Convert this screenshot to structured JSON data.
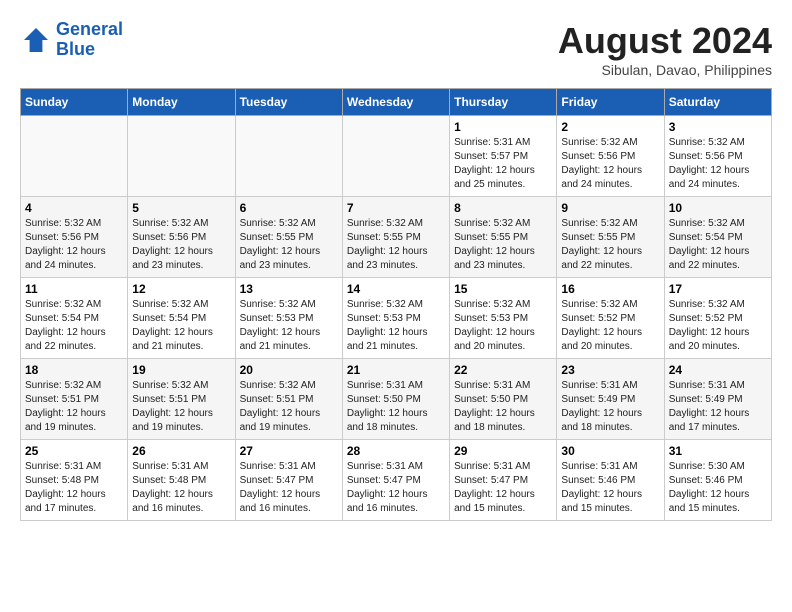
{
  "header": {
    "logo_line1": "General",
    "logo_line2": "Blue",
    "month_year": "August 2024",
    "location": "Sibulan, Davao, Philippines"
  },
  "weekdays": [
    "Sunday",
    "Monday",
    "Tuesday",
    "Wednesday",
    "Thursday",
    "Friday",
    "Saturday"
  ],
  "weeks": [
    [
      {
        "day": "",
        "info": ""
      },
      {
        "day": "",
        "info": ""
      },
      {
        "day": "",
        "info": ""
      },
      {
        "day": "",
        "info": ""
      },
      {
        "day": "1",
        "info": "Sunrise: 5:31 AM\nSunset: 5:57 PM\nDaylight: 12 hours\nand 25 minutes."
      },
      {
        "day": "2",
        "info": "Sunrise: 5:32 AM\nSunset: 5:56 PM\nDaylight: 12 hours\nand 24 minutes."
      },
      {
        "day": "3",
        "info": "Sunrise: 5:32 AM\nSunset: 5:56 PM\nDaylight: 12 hours\nand 24 minutes."
      }
    ],
    [
      {
        "day": "4",
        "info": "Sunrise: 5:32 AM\nSunset: 5:56 PM\nDaylight: 12 hours\nand 24 minutes."
      },
      {
        "day": "5",
        "info": "Sunrise: 5:32 AM\nSunset: 5:56 PM\nDaylight: 12 hours\nand 23 minutes."
      },
      {
        "day": "6",
        "info": "Sunrise: 5:32 AM\nSunset: 5:55 PM\nDaylight: 12 hours\nand 23 minutes."
      },
      {
        "day": "7",
        "info": "Sunrise: 5:32 AM\nSunset: 5:55 PM\nDaylight: 12 hours\nand 23 minutes."
      },
      {
        "day": "8",
        "info": "Sunrise: 5:32 AM\nSunset: 5:55 PM\nDaylight: 12 hours\nand 23 minutes."
      },
      {
        "day": "9",
        "info": "Sunrise: 5:32 AM\nSunset: 5:55 PM\nDaylight: 12 hours\nand 22 minutes."
      },
      {
        "day": "10",
        "info": "Sunrise: 5:32 AM\nSunset: 5:54 PM\nDaylight: 12 hours\nand 22 minutes."
      }
    ],
    [
      {
        "day": "11",
        "info": "Sunrise: 5:32 AM\nSunset: 5:54 PM\nDaylight: 12 hours\nand 22 minutes."
      },
      {
        "day": "12",
        "info": "Sunrise: 5:32 AM\nSunset: 5:54 PM\nDaylight: 12 hours\nand 21 minutes."
      },
      {
        "day": "13",
        "info": "Sunrise: 5:32 AM\nSunset: 5:53 PM\nDaylight: 12 hours\nand 21 minutes."
      },
      {
        "day": "14",
        "info": "Sunrise: 5:32 AM\nSunset: 5:53 PM\nDaylight: 12 hours\nand 21 minutes."
      },
      {
        "day": "15",
        "info": "Sunrise: 5:32 AM\nSunset: 5:53 PM\nDaylight: 12 hours\nand 20 minutes."
      },
      {
        "day": "16",
        "info": "Sunrise: 5:32 AM\nSunset: 5:52 PM\nDaylight: 12 hours\nand 20 minutes."
      },
      {
        "day": "17",
        "info": "Sunrise: 5:32 AM\nSunset: 5:52 PM\nDaylight: 12 hours\nand 20 minutes."
      }
    ],
    [
      {
        "day": "18",
        "info": "Sunrise: 5:32 AM\nSunset: 5:51 PM\nDaylight: 12 hours\nand 19 minutes."
      },
      {
        "day": "19",
        "info": "Sunrise: 5:32 AM\nSunset: 5:51 PM\nDaylight: 12 hours\nand 19 minutes."
      },
      {
        "day": "20",
        "info": "Sunrise: 5:32 AM\nSunset: 5:51 PM\nDaylight: 12 hours\nand 19 minutes."
      },
      {
        "day": "21",
        "info": "Sunrise: 5:31 AM\nSunset: 5:50 PM\nDaylight: 12 hours\nand 18 minutes."
      },
      {
        "day": "22",
        "info": "Sunrise: 5:31 AM\nSunset: 5:50 PM\nDaylight: 12 hours\nand 18 minutes."
      },
      {
        "day": "23",
        "info": "Sunrise: 5:31 AM\nSunset: 5:49 PM\nDaylight: 12 hours\nand 18 minutes."
      },
      {
        "day": "24",
        "info": "Sunrise: 5:31 AM\nSunset: 5:49 PM\nDaylight: 12 hours\nand 17 minutes."
      }
    ],
    [
      {
        "day": "25",
        "info": "Sunrise: 5:31 AM\nSunset: 5:48 PM\nDaylight: 12 hours\nand 17 minutes."
      },
      {
        "day": "26",
        "info": "Sunrise: 5:31 AM\nSunset: 5:48 PM\nDaylight: 12 hours\nand 16 minutes."
      },
      {
        "day": "27",
        "info": "Sunrise: 5:31 AM\nSunset: 5:47 PM\nDaylight: 12 hours\nand 16 minutes."
      },
      {
        "day": "28",
        "info": "Sunrise: 5:31 AM\nSunset: 5:47 PM\nDaylight: 12 hours\nand 16 minutes."
      },
      {
        "day": "29",
        "info": "Sunrise: 5:31 AM\nSunset: 5:47 PM\nDaylight: 12 hours\nand 15 minutes."
      },
      {
        "day": "30",
        "info": "Sunrise: 5:31 AM\nSunset: 5:46 PM\nDaylight: 12 hours\nand 15 minutes."
      },
      {
        "day": "31",
        "info": "Sunrise: 5:30 AM\nSunset: 5:46 PM\nDaylight: 12 hours\nand 15 minutes."
      }
    ]
  ]
}
